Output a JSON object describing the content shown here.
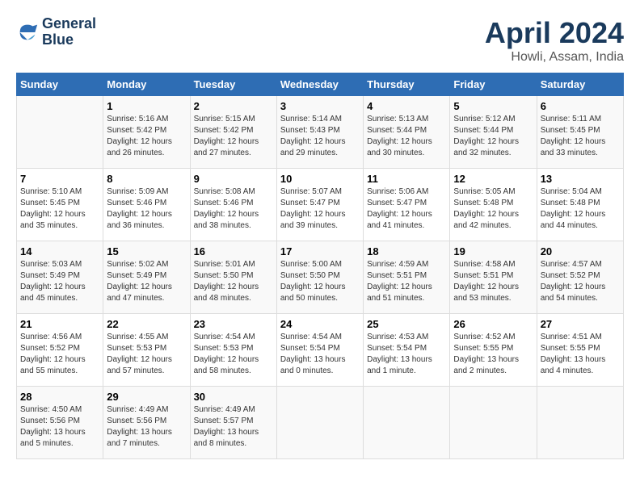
{
  "header": {
    "logo_line1": "General",
    "logo_line2": "Blue",
    "month_year": "April 2024",
    "location": "Howli, Assam, India"
  },
  "weekdays": [
    "Sunday",
    "Monday",
    "Tuesday",
    "Wednesday",
    "Thursday",
    "Friday",
    "Saturday"
  ],
  "weeks": [
    [
      {
        "date": "",
        "sunrise": "",
        "sunset": "",
        "daylight": ""
      },
      {
        "date": "1",
        "sunrise": "Sunrise: 5:16 AM",
        "sunset": "Sunset: 5:42 PM",
        "daylight": "Daylight: 12 hours and 26 minutes."
      },
      {
        "date": "2",
        "sunrise": "Sunrise: 5:15 AM",
        "sunset": "Sunset: 5:42 PM",
        "daylight": "Daylight: 12 hours and 27 minutes."
      },
      {
        "date": "3",
        "sunrise": "Sunrise: 5:14 AM",
        "sunset": "Sunset: 5:43 PM",
        "daylight": "Daylight: 12 hours and 29 minutes."
      },
      {
        "date": "4",
        "sunrise": "Sunrise: 5:13 AM",
        "sunset": "Sunset: 5:44 PM",
        "daylight": "Daylight: 12 hours and 30 minutes."
      },
      {
        "date": "5",
        "sunrise": "Sunrise: 5:12 AM",
        "sunset": "Sunset: 5:44 PM",
        "daylight": "Daylight: 12 hours and 32 minutes."
      },
      {
        "date": "6",
        "sunrise": "Sunrise: 5:11 AM",
        "sunset": "Sunset: 5:45 PM",
        "daylight": "Daylight: 12 hours and 33 minutes."
      }
    ],
    [
      {
        "date": "7",
        "sunrise": "Sunrise: 5:10 AM",
        "sunset": "Sunset: 5:45 PM",
        "daylight": "Daylight: 12 hours and 35 minutes."
      },
      {
        "date": "8",
        "sunrise": "Sunrise: 5:09 AM",
        "sunset": "Sunset: 5:46 PM",
        "daylight": "Daylight: 12 hours and 36 minutes."
      },
      {
        "date": "9",
        "sunrise": "Sunrise: 5:08 AM",
        "sunset": "Sunset: 5:46 PM",
        "daylight": "Daylight: 12 hours and 38 minutes."
      },
      {
        "date": "10",
        "sunrise": "Sunrise: 5:07 AM",
        "sunset": "Sunset: 5:47 PM",
        "daylight": "Daylight: 12 hours and 39 minutes."
      },
      {
        "date": "11",
        "sunrise": "Sunrise: 5:06 AM",
        "sunset": "Sunset: 5:47 PM",
        "daylight": "Daylight: 12 hours and 41 minutes."
      },
      {
        "date": "12",
        "sunrise": "Sunrise: 5:05 AM",
        "sunset": "Sunset: 5:48 PM",
        "daylight": "Daylight: 12 hours and 42 minutes."
      },
      {
        "date": "13",
        "sunrise": "Sunrise: 5:04 AM",
        "sunset": "Sunset: 5:48 PM",
        "daylight": "Daylight: 12 hours and 44 minutes."
      }
    ],
    [
      {
        "date": "14",
        "sunrise": "Sunrise: 5:03 AM",
        "sunset": "Sunset: 5:49 PM",
        "daylight": "Daylight: 12 hours and 45 minutes."
      },
      {
        "date": "15",
        "sunrise": "Sunrise: 5:02 AM",
        "sunset": "Sunset: 5:49 PM",
        "daylight": "Daylight: 12 hours and 47 minutes."
      },
      {
        "date": "16",
        "sunrise": "Sunrise: 5:01 AM",
        "sunset": "Sunset: 5:50 PM",
        "daylight": "Daylight: 12 hours and 48 minutes."
      },
      {
        "date": "17",
        "sunrise": "Sunrise: 5:00 AM",
        "sunset": "Sunset: 5:50 PM",
        "daylight": "Daylight: 12 hours and 50 minutes."
      },
      {
        "date": "18",
        "sunrise": "Sunrise: 4:59 AM",
        "sunset": "Sunset: 5:51 PM",
        "daylight": "Daylight: 12 hours and 51 minutes."
      },
      {
        "date": "19",
        "sunrise": "Sunrise: 4:58 AM",
        "sunset": "Sunset: 5:51 PM",
        "daylight": "Daylight: 12 hours and 53 minutes."
      },
      {
        "date": "20",
        "sunrise": "Sunrise: 4:57 AM",
        "sunset": "Sunset: 5:52 PM",
        "daylight": "Daylight: 12 hours and 54 minutes."
      }
    ],
    [
      {
        "date": "21",
        "sunrise": "Sunrise: 4:56 AM",
        "sunset": "Sunset: 5:52 PM",
        "daylight": "Daylight: 12 hours and 55 minutes."
      },
      {
        "date": "22",
        "sunrise": "Sunrise: 4:55 AM",
        "sunset": "Sunset: 5:53 PM",
        "daylight": "Daylight: 12 hours and 57 minutes."
      },
      {
        "date": "23",
        "sunrise": "Sunrise: 4:54 AM",
        "sunset": "Sunset: 5:53 PM",
        "daylight": "Daylight: 12 hours and 58 minutes."
      },
      {
        "date": "24",
        "sunrise": "Sunrise: 4:54 AM",
        "sunset": "Sunset: 5:54 PM",
        "daylight": "Daylight: 13 hours and 0 minutes."
      },
      {
        "date": "25",
        "sunrise": "Sunrise: 4:53 AM",
        "sunset": "Sunset: 5:54 PM",
        "daylight": "Daylight: 13 hours and 1 minute."
      },
      {
        "date": "26",
        "sunrise": "Sunrise: 4:52 AM",
        "sunset": "Sunset: 5:55 PM",
        "daylight": "Daylight: 13 hours and 2 minutes."
      },
      {
        "date": "27",
        "sunrise": "Sunrise: 4:51 AM",
        "sunset": "Sunset: 5:55 PM",
        "daylight": "Daylight: 13 hours and 4 minutes."
      }
    ],
    [
      {
        "date": "28",
        "sunrise": "Sunrise: 4:50 AM",
        "sunset": "Sunset: 5:56 PM",
        "daylight": "Daylight: 13 hours and 5 minutes."
      },
      {
        "date": "29",
        "sunrise": "Sunrise: 4:49 AM",
        "sunset": "Sunset: 5:56 PM",
        "daylight": "Daylight: 13 hours and 7 minutes."
      },
      {
        "date": "30",
        "sunrise": "Sunrise: 4:49 AM",
        "sunset": "Sunset: 5:57 PM",
        "daylight": "Daylight: 13 hours and 8 minutes."
      },
      {
        "date": "",
        "sunrise": "",
        "sunset": "",
        "daylight": ""
      },
      {
        "date": "",
        "sunrise": "",
        "sunset": "",
        "daylight": ""
      },
      {
        "date": "",
        "sunrise": "",
        "sunset": "",
        "daylight": ""
      },
      {
        "date": "",
        "sunrise": "",
        "sunset": "",
        "daylight": ""
      }
    ]
  ]
}
